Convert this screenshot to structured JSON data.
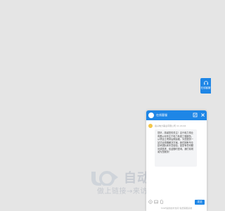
{
  "watermark": {
    "title": "自动秒收录",
    "subtitle": "做上链接→来访一次→自动收录"
  },
  "float_button": {
    "label": "在线客服",
    "icon": "headset-icon"
  },
  "chat": {
    "header": {
      "title": "在线客服",
      "avatar_icon": "avatar-icon",
      "minimize_icon": "minimize-icon",
      "close_icon": "close-icon"
    },
    "message": {
      "sender": "嘉兴电力事业有限公司",
      "time": "11:24:44",
      "text": "您好，感谢您的关注！嘉兴电力事业有限公司专注于电力系统工程服务，从项目立项到后期运维，为您提供一站式全周期解决方案。我们拥有专业技术团队和丰富经验，如您有任何疑问或需求，欢迎随时咨询，我们将竭诚为您服务！"
    },
    "toolbar": {
      "icons": [
        "emoji-icon",
        "image-icon",
        "file-icon"
      ],
      "send_label": "发送"
    },
    "powered_by": "53KF提供技术支持 免费客服系统"
  },
  "colors": {
    "accent": "#1e86e6",
    "background": "#e5e5e5",
    "watermark": "#c8ccd2"
  }
}
